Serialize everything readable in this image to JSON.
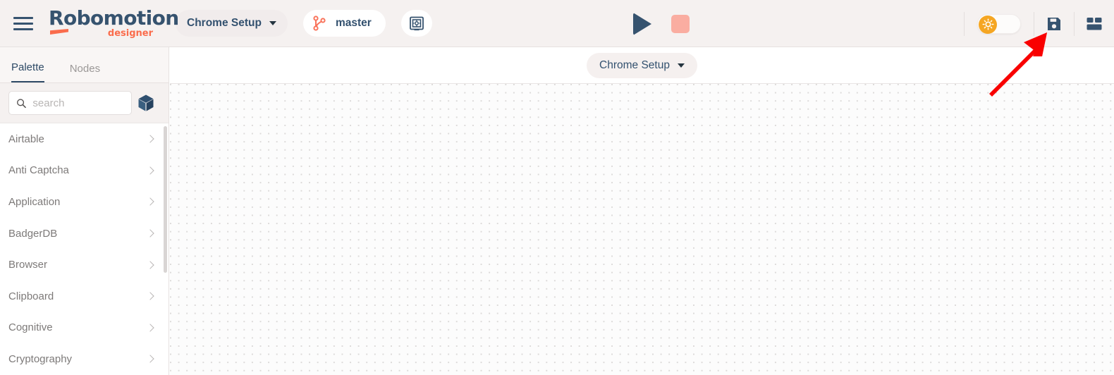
{
  "app": {
    "brand_name": "Robomotion",
    "brand_sub": "designer",
    "accent_navy": "#36536f",
    "accent_coral": "#fa6c4c",
    "accent_orange": "#f5a623",
    "accent_salmon": "#faada1",
    "header_bg": "#f5f1f0"
  },
  "header": {
    "menu_icon": "hamburger-menu-icon",
    "flow_selector": {
      "label": "Chrome Setup",
      "caret_icon": "chevron-down-icon"
    },
    "branch_selector": {
      "label": "master",
      "icon": "git-branch-icon"
    },
    "vault_button": {
      "icon": "vault-icon"
    },
    "run_button": {
      "icon": "play-icon"
    },
    "stop_button": {
      "icon": "stop-square-icon"
    },
    "theme_toggle": {
      "icon": "sun-icon",
      "state": "light"
    },
    "save_button": {
      "icon": "floppy-disk-save-icon"
    },
    "layout_button": {
      "icon": "layout-panels-icon"
    }
  },
  "sidebar": {
    "tabs": [
      {
        "label": "Palette",
        "active": true
      },
      {
        "label": "Nodes",
        "active": false
      }
    ],
    "search": {
      "placeholder": "search",
      "value": "",
      "icon": "search-icon"
    },
    "packages_button": {
      "icon": "cube-package-icon"
    },
    "items": [
      {
        "label": "Airtable"
      },
      {
        "label": "Anti Captcha"
      },
      {
        "label": "Application"
      },
      {
        "label": "BadgerDB"
      },
      {
        "label": "Browser"
      },
      {
        "label": "Clipboard"
      },
      {
        "label": "Cognitive"
      },
      {
        "label": "Cryptography"
      }
    ],
    "item_chevron_icon": "chevron-right-icon"
  },
  "canvas": {
    "breadcrumb": {
      "label": "Chrome Setup",
      "caret_icon": "chevron-down-icon"
    },
    "grid": "dot-grid"
  },
  "annotation": {
    "arrow": {
      "color": "#f90000",
      "points_to": "save-button"
    }
  }
}
